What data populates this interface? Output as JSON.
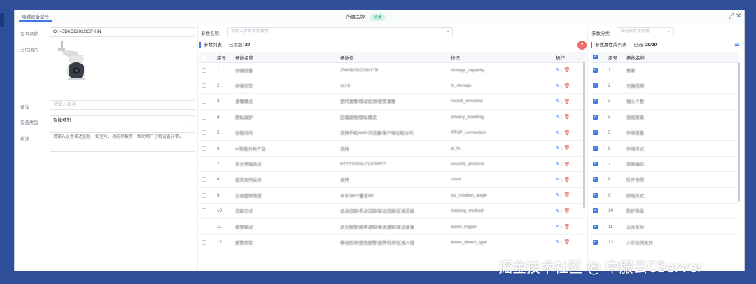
{
  "window": {
    "tab_title": "编辑设备型号",
    "brand_label": "所属品牌:",
    "brand_value": "迪普",
    "expand_icon": "expand-icon",
    "close_icon": "close-icon"
  },
  "left": {
    "model_label": "型号名称",
    "model_value": "OH-SD6C8202SGF-HN",
    "image_label": "上传图片",
    "note_label": "备注",
    "note_placeholder": "请输入备注",
    "type_label": "设备类型",
    "type_value": "智能球机",
    "desc_label": "描述",
    "desc_value": "请输入设备描述信息，如型号、功能参数等，帮助用户了解设备详情。"
  },
  "search": {
    "label": "参数名称:",
    "placeholder": "请输入参数名称搜索",
    "category_label": "参数分类:",
    "category_placeholder": "请选择参数分类"
  },
  "param_list": {
    "title": "参数列表",
    "added_label": "已添加:",
    "added_count": "20",
    "headers": {
      "index": "序号",
      "name": "参数名称",
      "value": "参数值",
      "tag": "标识",
      "op": "操作"
    },
    "rows": [
      {
        "index": "1",
        "name": "存储容量",
        "value": "256GB/512GB/1TB",
        "tag": "storage_capacity"
      },
      {
        "index": "2",
        "name": "存储类型",
        "value": "SD卡",
        "tag": "fc_storage"
      },
      {
        "index": "3",
        "name": "录像模式",
        "value": "定时录像/移动侦测/报警录像",
        "tag": "record_encoded"
      },
      {
        "index": "4",
        "name": "隐私保护",
        "value": "区域遮挡/隐私模式",
        "tag": "privacy_masking"
      },
      {
        "index": "5",
        "name": "远程访问",
        "value": "支持手机APP/浏览器/客户端远程访问",
        "tag": "RTSP_connection"
      },
      {
        "index": "6",
        "name": "AI智能分析产品",
        "value": "支持",
        "tag": "ai_fn"
      },
      {
        "index": "7",
        "name": "安全传输协议",
        "value": "HTTPS/SSL/TLS/SRTP",
        "tag": "security_protocol"
      },
      {
        "index": "8",
        "name": "是否支持云台",
        "value": "支持",
        "tag": "cloud"
      },
      {
        "index": "9",
        "name": "云台旋转角度",
        "value": "水平360°/垂直90°",
        "tag": "ptz_rotation_angle"
      },
      {
        "index": "10",
        "name": "追踪方式",
        "value": "自动追踪/手动追踪/联动追踪/区域追踪",
        "tag": "tracking_method"
      },
      {
        "index": "11",
        "name": "报警联动",
        "value": "声光报警/邮件通知/推送通知/联动录像",
        "tag": "alarm_trigger"
      },
      {
        "index": "12",
        "name": "报警类型",
        "value": "移动侦测/遮挡报警/越界检测/区域入侵",
        "tag": "alarm_detect_type"
      }
    ]
  },
  "lib_list": {
    "title": "参数属性库列表",
    "selected_label": "已选:",
    "selected_count": "20/20",
    "headers": {
      "index": "序号",
      "name": "参数名称"
    },
    "rows": [
      {
        "index": "1",
        "name": "像素"
      },
      {
        "index": "2",
        "name": "光圈范围"
      },
      {
        "index": "3",
        "name": "镜头个数"
      },
      {
        "index": "4",
        "name": "夜视距离"
      },
      {
        "index": "5",
        "name": "存储容量"
      },
      {
        "index": "6",
        "name": "存储方式"
      },
      {
        "index": "7",
        "name": "视频编码"
      },
      {
        "index": "8",
        "name": "红外夜视"
      },
      {
        "index": "9",
        "name": "供电方式"
      },
      {
        "index": "10",
        "name": "防护等级"
      },
      {
        "index": "11",
        "name": "云台支持"
      },
      {
        "index": "12",
        "name": "人形侦测支持"
      }
    ]
  },
  "watermark": "掘金技术社区 @ 中服云CServer",
  "colors": {
    "accent": "#3c7be0",
    "danger": "#e25555",
    "backdrop": "#2f4f9a",
    "badge_bg": "#d6f3ea",
    "badge_text": "#2a9d7a"
  }
}
